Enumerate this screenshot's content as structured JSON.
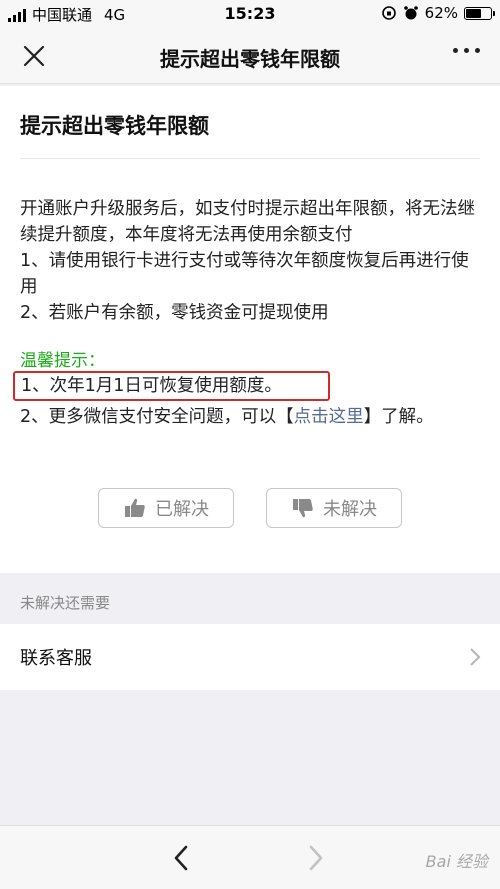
{
  "status_bar": {
    "carrier": "中国联通",
    "network": "4G",
    "time": "15:23",
    "battery": "62%",
    "battery_level": 0.62
  },
  "nav": {
    "title": "提示超出零钱年限额",
    "close_icon": "close-icon",
    "more_icon": "more-icon"
  },
  "article": {
    "title": "提示超出零钱年限额",
    "paragraphs": [
      "开通账户升级服务后，如支付时提示超出年限额，将无法继续提升额度，本年度将无法再使用余额支付",
      "1、请使用银行卡进行支付或等待次年额度恢复后再进行使用",
      "2、若账户有余额，零钱资金可提现使用"
    ],
    "tip_title": "温馨提示：",
    "tip_1": "1、次年1月1日可恢复使用额度。",
    "tip_2_prefix": "2、更多微信支付安全问题，可以【",
    "tip_2_link": "点击这里",
    "tip_2_suffix": "】了解。"
  },
  "feedback": {
    "resolved_label": "已解决",
    "unresolved_label": "未解决",
    "resolved_icon": "thumbs-up-icon",
    "unresolved_icon": "thumbs-down-icon"
  },
  "section": {
    "header": "未解决还需要",
    "contact_label": "联系客服"
  },
  "bottom_bar": {
    "back_icon": "chevron-left-icon",
    "forward_icon": "chevron-right-icon",
    "watermark": "Bai 经验"
  },
  "colors": {
    "tip_green": "#1aad19",
    "link_blue": "#576b95",
    "highlight_red": "#d12a2a"
  }
}
